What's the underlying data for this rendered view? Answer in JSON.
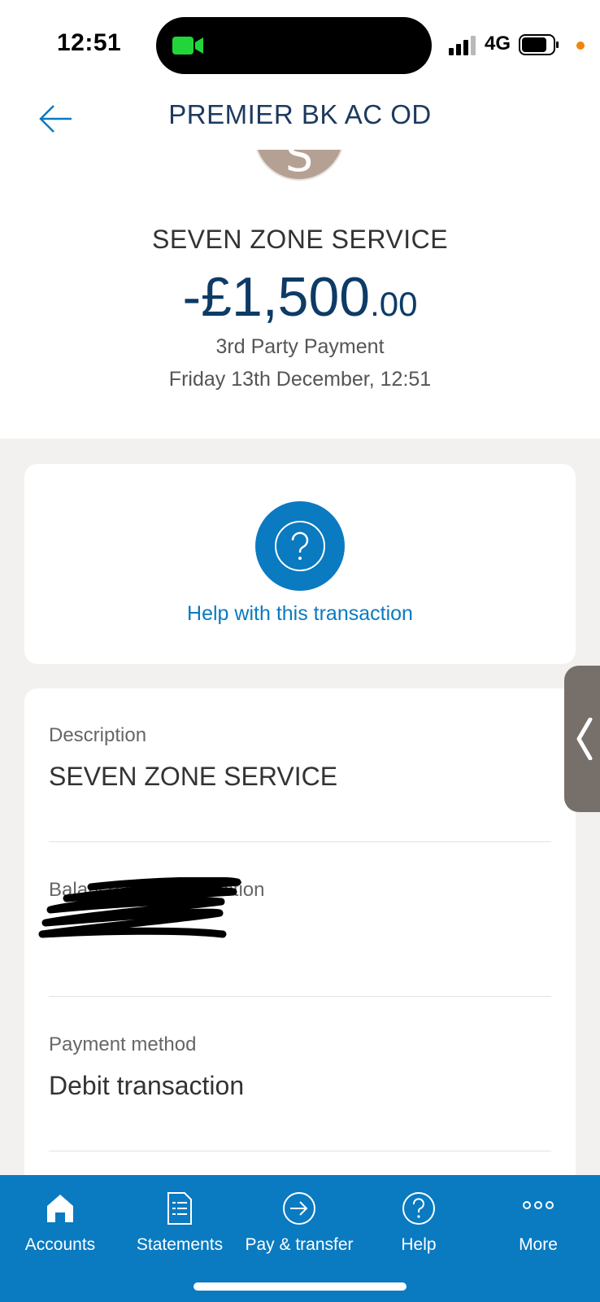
{
  "status_bar": {
    "time": "12:51",
    "network": "4G"
  },
  "header": {
    "title": "PREMIER BK AC OD"
  },
  "summary": {
    "avatar_initial": "S",
    "merchant": "SEVEN ZONE SERVICE",
    "amount_major": "-£1,500",
    "amount_minor": ".00",
    "payment_type": "3rd Party Payment",
    "datetime": "Friday 13th December, 12:51"
  },
  "help": {
    "label": "Help with this transaction"
  },
  "details": {
    "description_label": "Description",
    "description_value": "SEVEN ZONE SERVICE",
    "balance_label": "Balance after transaction",
    "payment_method_label": "Payment method",
    "payment_method_value": "Debit transaction"
  },
  "nav": {
    "items": [
      {
        "label": "Accounts",
        "icon": "home-icon"
      },
      {
        "label": "Statements",
        "icon": "document-icon"
      },
      {
        "label": "Pay & transfer",
        "icon": "arrow-circle-icon"
      },
      {
        "label": "Help",
        "icon": "question-circle-icon"
      },
      {
        "label": "More",
        "icon": "more-dots-icon"
      }
    ]
  },
  "colors": {
    "brand_blue": "#0a7ac1",
    "title_navy": "#1d3a5f",
    "amount_navy": "#0d3b66",
    "avatar": "#b5a193"
  }
}
